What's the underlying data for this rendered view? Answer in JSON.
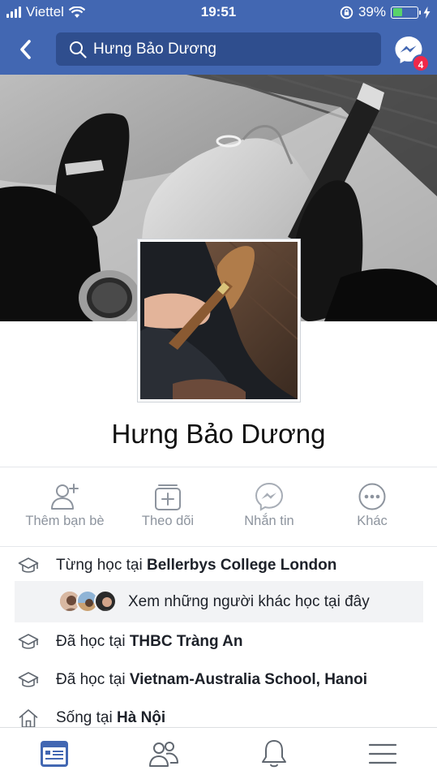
{
  "status_bar": {
    "carrier": "Viettel",
    "time": "19:51",
    "battery_percent": "39%",
    "battery_level": 0.39,
    "icons": [
      "signal-icon",
      "wifi-icon",
      "rotation-lock-icon",
      "battery-icon",
      "charging-icon"
    ]
  },
  "nav": {
    "back_icon": "chevron-left-icon",
    "search_icon": "search-icon",
    "search_value": "Hưng Bảo Dương",
    "messenger_icon": "messenger-icon",
    "messenger_badge": "4"
  },
  "profile": {
    "name": "Hưng Bảo Dương",
    "cover_photo": "black-and-white photo of a hand holding a cigar",
    "profile_photo": "color photo of a hand holding a cigar"
  },
  "actions": [
    {
      "label": "Thêm bạn bè",
      "icon": "add-friend-icon"
    },
    {
      "label": "Theo dõi",
      "icon": "follow-icon"
    },
    {
      "label": "Nhắn tin",
      "icon": "message-icon"
    },
    {
      "label": "Khác",
      "icon": "more-icon"
    }
  ],
  "about": {
    "education_1": {
      "prefix": "Từng học tại ",
      "place": "Bellerbys College London",
      "icon": "graduation-cap-icon"
    },
    "see_others": "Xem những người khác học tại đây",
    "education_2": {
      "prefix": "Đã học tại ",
      "place": "THBC Tràng An",
      "icon": "graduation-cap-icon"
    },
    "education_3": {
      "prefix": "Đã học tại ",
      "place": "Vietnam-Australia School, Hanoi",
      "icon": "graduation-cap-icon"
    },
    "lives_in": {
      "prefix": "Sống tại ",
      "place": "Hà Nội",
      "icon": "home-icon"
    }
  },
  "tabbar": {
    "tabs": [
      "news-feed-icon",
      "friends-icon",
      "notifications-icon",
      "menu-icon"
    ],
    "active": 0
  },
  "colors": {
    "brand_blue": "#4267b2",
    "search_bg": "#2f4e8e",
    "badge_red": "#f02849",
    "muted_text": "#8d949e",
    "highlight_bg": "#f2f3f5"
  }
}
